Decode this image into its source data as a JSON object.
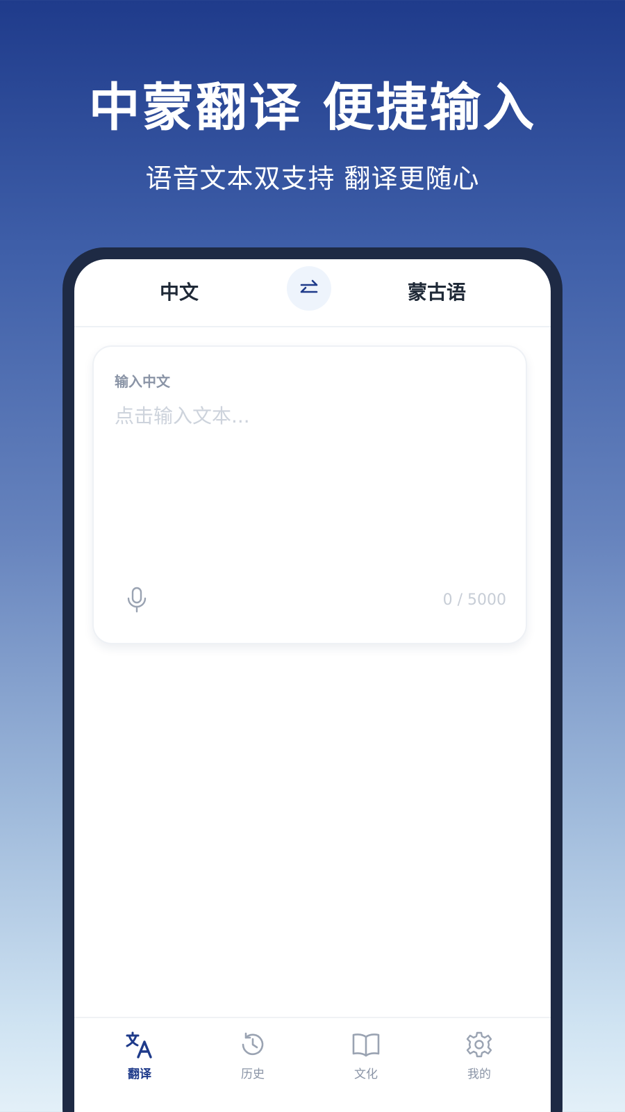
{
  "promo": {
    "headline": "中蒙翻译 便捷输入",
    "subline": "语音文本双支持 翻译更随心"
  },
  "language_bar": {
    "source": "中文",
    "target": "蒙古语",
    "swap_icon": "swap-arrows-icon"
  },
  "input_card": {
    "label": "输入中文",
    "placeholder": "点击输入文本...",
    "value": "",
    "mic_icon": "microphone-icon",
    "counter": "0 / 5000"
  },
  "tabs": [
    {
      "label": "翻译",
      "icon": "translate-icon",
      "active": true
    },
    {
      "label": "历史",
      "icon": "history-icon",
      "active": false
    },
    {
      "label": "文化",
      "icon": "book-icon",
      "active": false
    },
    {
      "label": "我的",
      "icon": "gear-icon",
      "active": false
    }
  ],
  "colors": {
    "accent": "#1e3a8a",
    "muted": "#8a94a6",
    "phone_frame": "#1e2a44"
  }
}
